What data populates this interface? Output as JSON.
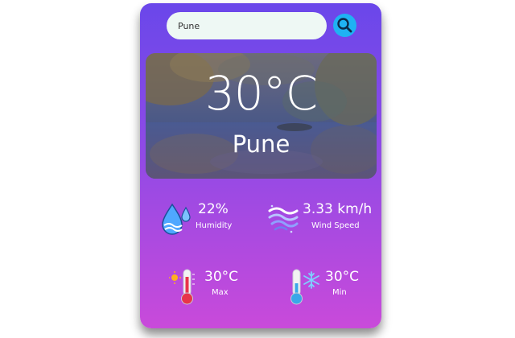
{
  "search": {
    "value": "Pune",
    "button_icon": "search-icon"
  },
  "current": {
    "temperature": "30°C",
    "city": "Pune"
  },
  "stats": {
    "humidity": {
      "value": "22%",
      "label": "Humidity",
      "icon": "humidity-icon"
    },
    "wind": {
      "value": "3.33 km/h",
      "label": "Wind Speed",
      "icon": "wind-icon"
    },
    "max": {
      "value": "30°C",
      "label": "Max",
      "icon": "hot-thermometer-icon"
    },
    "min": {
      "value": "30°C",
      "label": "Min",
      "icon": "cold-thermometer-icon"
    }
  },
  "colors": {
    "card_top": "#6a47ea",
    "card_bottom": "#c94ada",
    "search_button": "#1fb2f3",
    "search_field": "#eef8f4"
  }
}
